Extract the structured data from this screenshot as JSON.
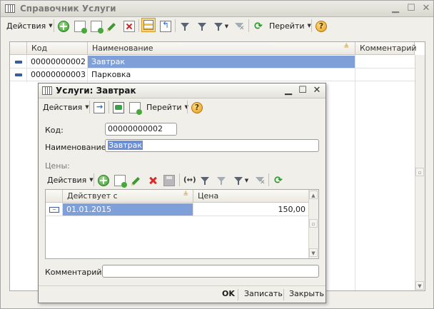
{
  "outer": {
    "title": "Справочник Услуги",
    "toolbar": {
      "actions_label": "Действия",
      "goto_label": "Перейти"
    },
    "table": {
      "columns": [
        "Код",
        "Наименование",
        "Комментарий"
      ],
      "rows": [
        {
          "code": "00000000002",
          "name": "Завтрак",
          "comment": ""
        },
        {
          "code": "00000000003",
          "name": "Парковка",
          "comment": ""
        }
      ]
    }
  },
  "dialog": {
    "title": "Услуги: Завтрак",
    "toolbar": {
      "actions_label": "Действия",
      "goto_label": "Перейти"
    },
    "fields": {
      "code_label": "Код:",
      "code_value": "00000000002",
      "name_label": "Наименование:",
      "name_value": "Завтрак",
      "comment_label": "Комментарий:",
      "comment_value": ""
    },
    "prices": {
      "section_label": "Цены:",
      "toolbar": {
        "actions_label": "Действия"
      },
      "columns": [
        "Действует с",
        "Цена"
      ],
      "rows": [
        {
          "date": "01.01.2015",
          "price": "150,00"
        }
      ]
    },
    "footer": {
      "ok_label": "OK",
      "save_label": "Записать",
      "close_label": "Закрыть"
    }
  },
  "colors": {
    "selection": "#7e9fd8",
    "title_bar": "#d9d8d0",
    "window_bg": "#f0efea"
  }
}
